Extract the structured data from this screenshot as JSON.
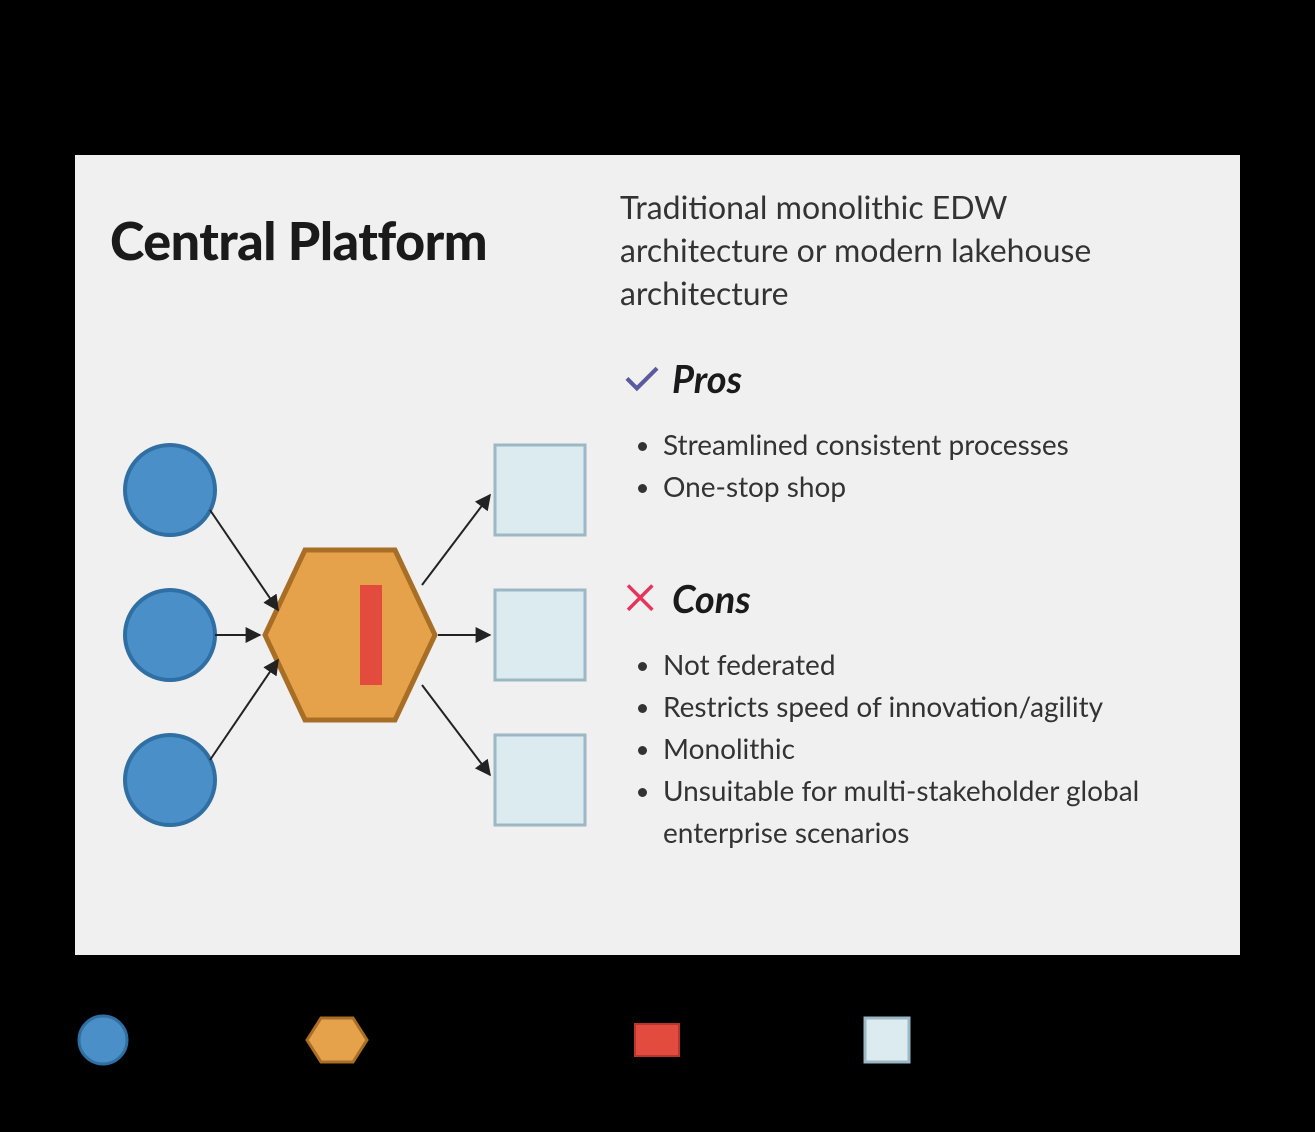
{
  "title": "Central Platform",
  "subtitle": "Traditional monolithic EDW architecture or modern lakehouse architecture",
  "pros": {
    "heading": "Pros",
    "items": [
      "Streamlined consistent processes",
      "One-stop shop"
    ]
  },
  "cons": {
    "heading": "Cons",
    "items": [
      "Not federated",
      "Restricts speed of innovation/agility",
      "Monolithic",
      "Unsuitable for multi-stakeholder global enterprise scenarios"
    ]
  },
  "colors": {
    "source": "#4a8fc7",
    "sourceStroke": "#2f6fa3",
    "platform": "#e6a24a",
    "platformStroke": "#a86e25",
    "catalog": "#e24b3e",
    "output": "#dcebf0",
    "outputStroke": "#9bb8c4",
    "check": "#5a5aa0",
    "cross": "#e6345a"
  },
  "legend": {
    "source": "",
    "platform": "",
    "catalog": "",
    "output": ""
  }
}
